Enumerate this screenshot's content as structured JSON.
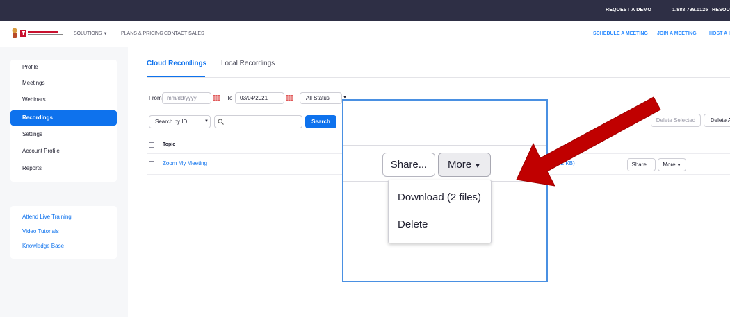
{
  "topbar": {
    "request_demo": "REQUEST A DEMO",
    "phone": "1.888.799.0125",
    "resources": "RESOUR"
  },
  "navbar": {
    "solutions": "SOLUTIONS",
    "plans_pricing": "PLANS & PRICING",
    "contact_sales": "CONTACT SALES",
    "schedule_meeting": "SCHEDULE A MEETING",
    "join_meeting": "JOIN A MEETING",
    "host_meeting": "HOST A I"
  },
  "sidebar": {
    "items": [
      {
        "label": "Profile"
      },
      {
        "label": "Meetings"
      },
      {
        "label": "Webinars"
      },
      {
        "label": "Recordings"
      },
      {
        "label": "Settings"
      },
      {
        "label": "Account Profile"
      },
      {
        "label": "Reports"
      }
    ],
    "active_index": 3,
    "links": [
      {
        "label": "Attend Live Training"
      },
      {
        "label": "Video Tutorials"
      },
      {
        "label": "Knowledge Base"
      }
    ]
  },
  "tabs": [
    {
      "label": "Cloud Recordings",
      "active": true
    },
    {
      "label": "Local Recordings",
      "active": false
    }
  ],
  "filters": {
    "from_label": "From",
    "from_placeholder": "mm/dd/yyyy",
    "to_label": "To",
    "to_value": "03/04/2021",
    "status_value": "All Status",
    "search_type": "Search by ID",
    "search_placeholder": "",
    "search_button": "Search",
    "delete_selected": "Delete Selected",
    "delete_all": "Delete A"
  },
  "table": {
    "header_topic": "Topic",
    "rows": [
      {
        "topic": "Zoom My Meeting",
        "size": "s (512 KB)",
        "share": "Share...",
        "more": "More"
      }
    ]
  },
  "zoom_callout": {
    "share": "Share...",
    "more": "More",
    "menu": [
      {
        "label": "Download (2 files)"
      },
      {
        "label": "Delete"
      }
    ]
  },
  "colors": {
    "accent": "#0e72ed",
    "topbar": "#2e2f45",
    "arrow": "#c00000",
    "callout_border": "#4a90e2"
  }
}
